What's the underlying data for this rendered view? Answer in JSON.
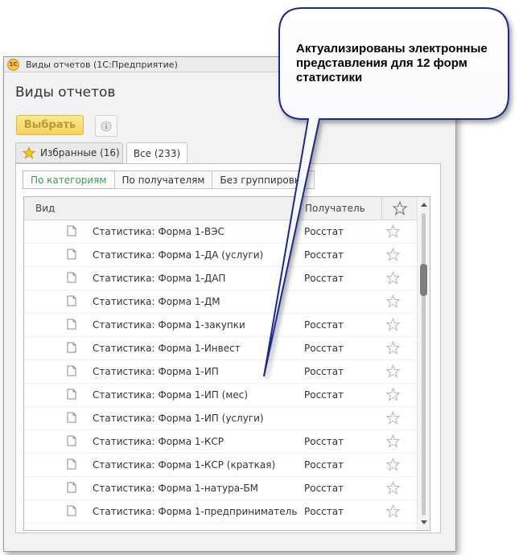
{
  "window": {
    "title": "Виды отчетов  (1С:Предприятие)",
    "app_icon_text": "1С"
  },
  "form_title": "Виды отчетов",
  "toolbar": {
    "select_label": "Выбрать",
    "info_icon": "info-icon"
  },
  "tabs": [
    {
      "label": "Избранные (16)",
      "icon": "star-icon"
    },
    {
      "label": "Все (233)"
    }
  ],
  "grouping": {
    "buttons": [
      "По категориям",
      "По получателям",
      "Без группировки"
    ],
    "active_index": 0
  },
  "grid": {
    "columns": {
      "view": "Вид",
      "recipient": "Получатель",
      "favorite_icon": "star-icon"
    },
    "rows": [
      {
        "name": "Статистика: Форма 1-ВЭС",
        "recipient": "Росстат"
      },
      {
        "name": "Статистика: Форма 1-ДА (услуги)",
        "recipient": "Росстат"
      },
      {
        "name": "Статистика: Форма 1-ДАП",
        "recipient": "Росстат"
      },
      {
        "name": "Статистика: Форма 1-ДМ",
        "recipient": ""
      },
      {
        "name": "Статистика: Форма 1-закупки",
        "recipient": "Росстат"
      },
      {
        "name": "Статистика: Форма 1-Инвест",
        "recipient": "Росстат"
      },
      {
        "name": "Статистика: Форма 1-ИП",
        "recipient": "Росстат"
      },
      {
        "name": "Статистика: Форма 1-ИП (мес)",
        "recipient": "Росстат"
      },
      {
        "name": "Статистика: Форма 1-ИП (услуги)",
        "recipient": ""
      },
      {
        "name": "Статистика: Форма 1-КСР",
        "recipient": "Росстат"
      },
      {
        "name": "Статистика: Форма 1-КСР (краткая)",
        "recipient": "Росстат"
      },
      {
        "name": "Статистика: Форма 1-натура-БМ",
        "recipient": "Росстат"
      },
      {
        "name": "Статистика: Форма 1-предприниматель",
        "recipient": "Росстат"
      }
    ]
  },
  "callout": {
    "text": "Актуализированы электронные представления для 12 форм статистики"
  },
  "colors": {
    "active_tab_green": "#3c9a4f",
    "select_button_yellow": "#f3d55c",
    "callout_border": "#1f2a8c"
  }
}
